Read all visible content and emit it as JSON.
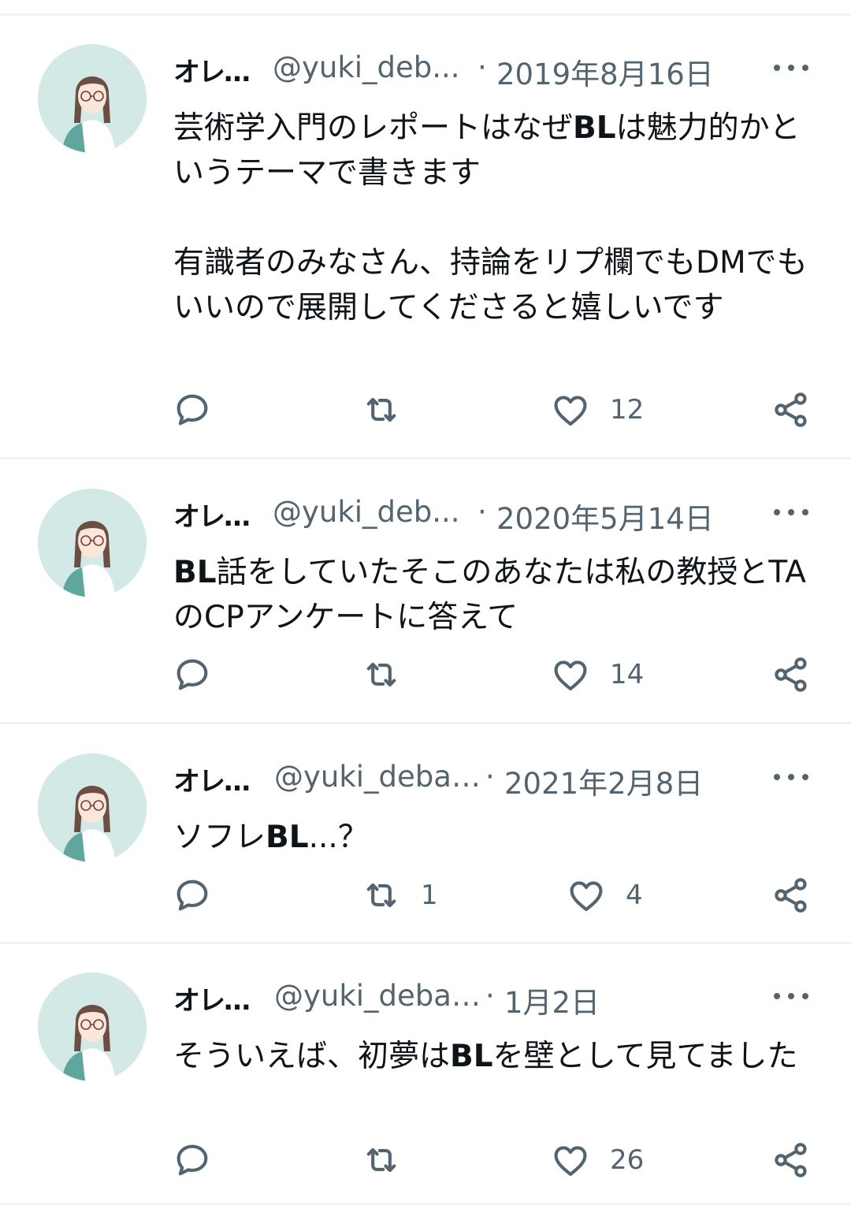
{
  "tweets": [
    {
      "name": "オレユ...",
      "handle": "@yuki_deb...",
      "separator": "·",
      "date": "2019年8月16日",
      "text_before": "芸術学入門のレポートはなぜ",
      "text_bold": "BL",
      "text_after": "は魅力的かというテーマで書きます\n\n有識者のみなさん、持論をリプ欄でもDMでもいいので展開してくださると嬉しいです",
      "reply_count": "",
      "retweet_count": "",
      "like_count": "12"
    },
    {
      "name": "オレユ...",
      "handle": "@yuki_deb...",
      "separator": "·",
      "date": "2020年5月14日",
      "text_before": "",
      "text_bold": "BL",
      "text_after": "話をしていたそこのあなたは私の教授とTAのCPアンケートに答えて",
      "reply_count": "",
      "retweet_count": "",
      "like_count": "14"
    },
    {
      "name": "オレユキー!",
      "handle": "@yuki_debate",
      "separator": "·",
      "date": "2021年2月8日",
      "text_before": "ソフレ",
      "text_bold": "BL",
      "text_after": "...？",
      "reply_count": "",
      "retweet_count": "1",
      "like_count": "4"
    },
    {
      "name": "オレユキー!",
      "handle": "@yuki_debate",
      "separator": "·",
      "date": "1月2日",
      "text_before": "そういえば、初夢は",
      "text_bold": "BL",
      "text_after": "を壁として見てました",
      "reply_count": "",
      "retweet_count": "",
      "like_count": "26"
    }
  ],
  "icons": {
    "more": "more-horizontal-icon",
    "reply": "reply-icon",
    "retweet": "retweet-icon",
    "like": "like-icon",
    "share": "share-icon"
  },
  "colors": {
    "text": "#0f1419",
    "secondary": "#536471",
    "divider": "#eff3f4",
    "avatar_bg": "#d2e9e6"
  }
}
